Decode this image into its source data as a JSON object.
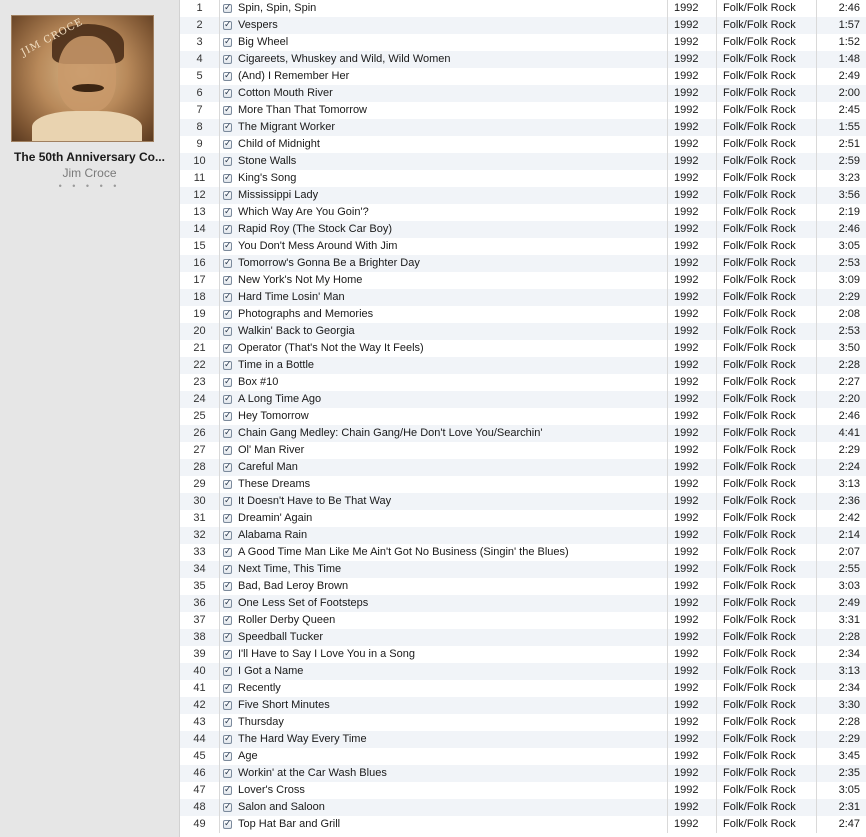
{
  "album": {
    "title": "The 50th Anniversary Co...",
    "artist": "Jim Croce",
    "rating": "• • • • •",
    "art_text": "JIM CROCE"
  },
  "tracks": [
    {
      "num": "1",
      "name": "Spin, Spin, Spin",
      "year": "1992",
      "genre": "Folk/Folk Rock",
      "time": "2:46"
    },
    {
      "num": "2",
      "name": "Vespers",
      "year": "1992",
      "genre": "Folk/Folk Rock",
      "time": "1:57"
    },
    {
      "num": "3",
      "name": "Big Wheel",
      "year": "1992",
      "genre": "Folk/Folk Rock",
      "time": "1:52"
    },
    {
      "num": "4",
      "name": "Cigareets, Whuskey and Wild, Wild Women",
      "year": "1992",
      "genre": "Folk/Folk Rock",
      "time": "1:48"
    },
    {
      "num": "5",
      "name": "(And) I Remember Her",
      "year": "1992",
      "genre": "Folk/Folk Rock",
      "time": "2:49"
    },
    {
      "num": "6",
      "name": "Cotton Mouth River",
      "year": "1992",
      "genre": "Folk/Folk Rock",
      "time": "2:00"
    },
    {
      "num": "7",
      "name": "More Than That Tomorrow",
      "year": "1992",
      "genre": "Folk/Folk Rock",
      "time": "2:45"
    },
    {
      "num": "8",
      "name": "The Migrant Worker",
      "year": "1992",
      "genre": "Folk/Folk Rock",
      "time": "1:55"
    },
    {
      "num": "9",
      "name": "Child of Midnight",
      "year": "1992",
      "genre": "Folk/Folk Rock",
      "time": "2:51"
    },
    {
      "num": "10",
      "name": "Stone Walls",
      "year": "1992",
      "genre": "Folk/Folk Rock",
      "time": "2:59"
    },
    {
      "num": "11",
      "name": "King's Song",
      "year": "1992",
      "genre": "Folk/Folk Rock",
      "time": "3:23"
    },
    {
      "num": "12",
      "name": "Mississippi Lady",
      "year": "1992",
      "genre": "Folk/Folk Rock",
      "time": "3:56"
    },
    {
      "num": "13",
      "name": "Which Way Are You Goin'?",
      "year": "1992",
      "genre": "Folk/Folk Rock",
      "time": "2:19"
    },
    {
      "num": "14",
      "name": "Rapid Roy (The Stock Car Boy)",
      "year": "1992",
      "genre": "Folk/Folk Rock",
      "time": "2:46"
    },
    {
      "num": "15",
      "name": "You Don't Mess Around With Jim",
      "year": "1992",
      "genre": "Folk/Folk Rock",
      "time": "3:05"
    },
    {
      "num": "16",
      "name": "Tomorrow's Gonna Be a Brighter Day",
      "year": "1992",
      "genre": "Folk/Folk Rock",
      "time": "2:53"
    },
    {
      "num": "17",
      "name": "New York's Not My Home",
      "year": "1992",
      "genre": "Folk/Folk Rock",
      "time": "3:09"
    },
    {
      "num": "18",
      "name": "Hard Time Losin' Man",
      "year": "1992",
      "genre": "Folk/Folk Rock",
      "time": "2:29"
    },
    {
      "num": "19",
      "name": "Photographs and Memories",
      "year": "1992",
      "genre": "Folk/Folk Rock",
      "time": "2:08"
    },
    {
      "num": "20",
      "name": "Walkin' Back to Georgia",
      "year": "1992",
      "genre": "Folk/Folk Rock",
      "time": "2:53"
    },
    {
      "num": "21",
      "name": "Operator (That's Not the Way It Feels)",
      "year": "1992",
      "genre": "Folk/Folk Rock",
      "time": "3:50"
    },
    {
      "num": "22",
      "name": "Time in a Bottle",
      "year": "1992",
      "genre": "Folk/Folk Rock",
      "time": "2:28"
    },
    {
      "num": "23",
      "name": "Box #10",
      "year": "1992",
      "genre": "Folk/Folk Rock",
      "time": "2:27"
    },
    {
      "num": "24",
      "name": "A Long Time Ago",
      "year": "1992",
      "genre": "Folk/Folk Rock",
      "time": "2:20"
    },
    {
      "num": "25",
      "name": "Hey Tomorrow",
      "year": "1992",
      "genre": "Folk/Folk Rock",
      "time": "2:46"
    },
    {
      "num": "26",
      "name": "Chain Gang Medley: Chain Gang/He Don't Love You/Searchin'",
      "year": "1992",
      "genre": "Folk/Folk Rock",
      "time": "4:41"
    },
    {
      "num": "27",
      "name": "Ol' Man River",
      "year": "1992",
      "genre": "Folk/Folk Rock",
      "time": "2:29"
    },
    {
      "num": "28",
      "name": "Careful Man",
      "year": "1992",
      "genre": "Folk/Folk Rock",
      "time": "2:24"
    },
    {
      "num": "29",
      "name": "These Dreams",
      "year": "1992",
      "genre": "Folk/Folk Rock",
      "time": "3:13"
    },
    {
      "num": "30",
      "name": "It Doesn't Have to Be That Way",
      "year": "1992",
      "genre": "Folk/Folk Rock",
      "time": "2:36"
    },
    {
      "num": "31",
      "name": "Dreamin' Again",
      "year": "1992",
      "genre": "Folk/Folk Rock",
      "time": "2:42"
    },
    {
      "num": "32",
      "name": "Alabama Rain",
      "year": "1992",
      "genre": "Folk/Folk Rock",
      "time": "2:14"
    },
    {
      "num": "33",
      "name": "A Good Time Man Like Me Ain't Got No Business (Singin' the Blues)",
      "year": "1992",
      "genre": "Folk/Folk Rock",
      "time": "2:07"
    },
    {
      "num": "34",
      "name": "Next Time, This Time",
      "year": "1992",
      "genre": "Folk/Folk Rock",
      "time": "2:55"
    },
    {
      "num": "35",
      "name": "Bad, Bad Leroy Brown",
      "year": "1992",
      "genre": "Folk/Folk Rock",
      "time": "3:03"
    },
    {
      "num": "36",
      "name": "One Less Set of Footsteps",
      "year": "1992",
      "genre": "Folk/Folk Rock",
      "time": "2:49"
    },
    {
      "num": "37",
      "name": "Roller Derby Queen",
      "year": "1992",
      "genre": "Folk/Folk Rock",
      "time": "3:31"
    },
    {
      "num": "38",
      "name": "Speedball Tucker",
      "year": "1992",
      "genre": "Folk/Folk Rock",
      "time": "2:28"
    },
    {
      "num": "39",
      "name": "I'll Have to Say I Love You in a Song",
      "year": "1992",
      "genre": "Folk/Folk Rock",
      "time": "2:34"
    },
    {
      "num": "40",
      "name": "I Got a Name",
      "year": "1992",
      "genre": "Folk/Folk Rock",
      "time": "3:13"
    },
    {
      "num": "41",
      "name": "Recently",
      "year": "1992",
      "genre": "Folk/Folk Rock",
      "time": "2:34"
    },
    {
      "num": "42",
      "name": "Five Short Minutes",
      "year": "1992",
      "genre": "Folk/Folk Rock",
      "time": "3:30"
    },
    {
      "num": "43",
      "name": "Thursday",
      "year": "1992",
      "genre": "Folk/Folk Rock",
      "time": "2:28"
    },
    {
      "num": "44",
      "name": "The Hard Way Every Time",
      "year": "1992",
      "genre": "Folk/Folk Rock",
      "time": "2:29"
    },
    {
      "num": "45",
      "name": "Age",
      "year": "1992",
      "genre": "Folk/Folk Rock",
      "time": "3:45"
    },
    {
      "num": "46",
      "name": "Workin' at the Car Wash Blues",
      "year": "1992",
      "genre": "Folk/Folk Rock",
      "time": "2:35"
    },
    {
      "num": "47",
      "name": "Lover's Cross",
      "year": "1992",
      "genre": "Folk/Folk Rock",
      "time": "3:05"
    },
    {
      "num": "48",
      "name": "Salon and Saloon",
      "year": "1992",
      "genre": "Folk/Folk Rock",
      "time": "2:31"
    },
    {
      "num": "49",
      "name": "Top Hat Bar and Grill",
      "year": "1992",
      "genre": "Folk/Folk Rock",
      "time": "2:47"
    }
  ],
  "colors": {
    "stripe": "#f1f4f8",
    "sidebar": "#e6e6e6"
  }
}
